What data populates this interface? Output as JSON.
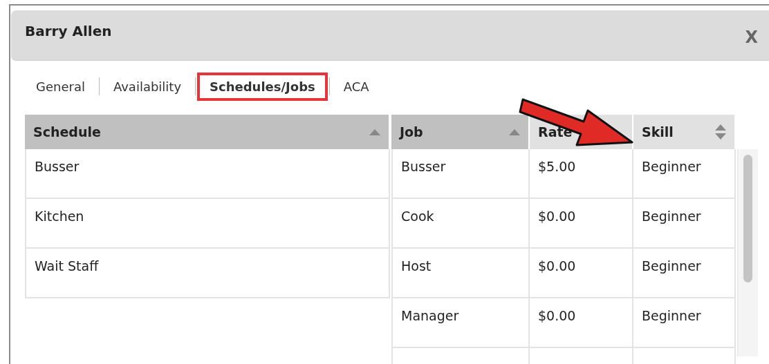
{
  "dialog": {
    "title": "Barry Allen",
    "close": "X"
  },
  "tabs": [
    {
      "label": "General",
      "selected": false
    },
    {
      "label": "Availability",
      "selected": false
    },
    {
      "label": "Schedules/Jobs",
      "selected": true
    },
    {
      "label": "ACA",
      "selected": false
    }
  ],
  "schedule_table": {
    "columns": [
      {
        "label": "Schedule",
        "sortable": true,
        "sorted": true
      }
    ],
    "rows": [
      [
        "Busser"
      ],
      [
        "Kitchen"
      ],
      [
        "Wait Staff"
      ]
    ]
  },
  "job_table": {
    "columns": [
      {
        "label": "Job",
        "sortable": true,
        "sorted": true
      },
      {
        "label": "Rate",
        "sortable": false,
        "sorted": false
      },
      {
        "label": "Skill",
        "sortable": true,
        "sorted": false
      }
    ],
    "rows": [
      [
        "Busser",
        "$5.00",
        "Beginner"
      ],
      [
        "Cook",
        "$0.00",
        "Beginner"
      ],
      [
        "Host",
        "$0.00",
        "Beginner"
      ],
      [
        "Manager",
        "$0.00",
        "Beginner"
      ],
      [
        "",
        "",
        ""
      ]
    ]
  }
}
